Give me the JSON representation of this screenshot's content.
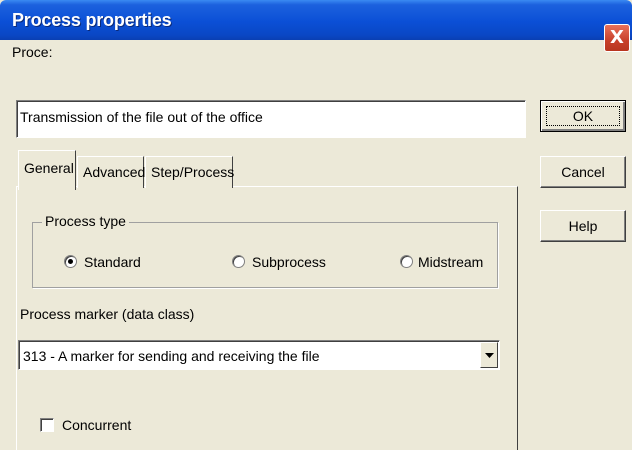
{
  "window": {
    "title": "Process properties",
    "close_glyph": "X"
  },
  "name_field": {
    "label": "Proce:",
    "value": "Transmission of the file out of the office"
  },
  "buttons": {
    "ok": "OK",
    "cancel": "Cancel",
    "help": "Help"
  },
  "tabs": [
    {
      "label": "General",
      "active": true
    },
    {
      "label": "Advanced",
      "active": false
    },
    {
      "label": "Step/Process",
      "active": false
    }
  ],
  "process_type": {
    "group_label": "Process type",
    "options": [
      {
        "label": "Standard",
        "selected": true
      },
      {
        "label": "Subprocess",
        "selected": false
      },
      {
        "label": "Midstream",
        "selected": false
      }
    ]
  },
  "process_marker": {
    "label": "Process marker (data class)",
    "selected_value": "313 - A marker for sending and receiving the file"
  },
  "concurrent": {
    "label": "Concurrent",
    "checked": false
  },
  "colors": {
    "titlebar": "#0b4fd6",
    "window_bg": "#ece9d8",
    "close_button": "#c8402a"
  }
}
